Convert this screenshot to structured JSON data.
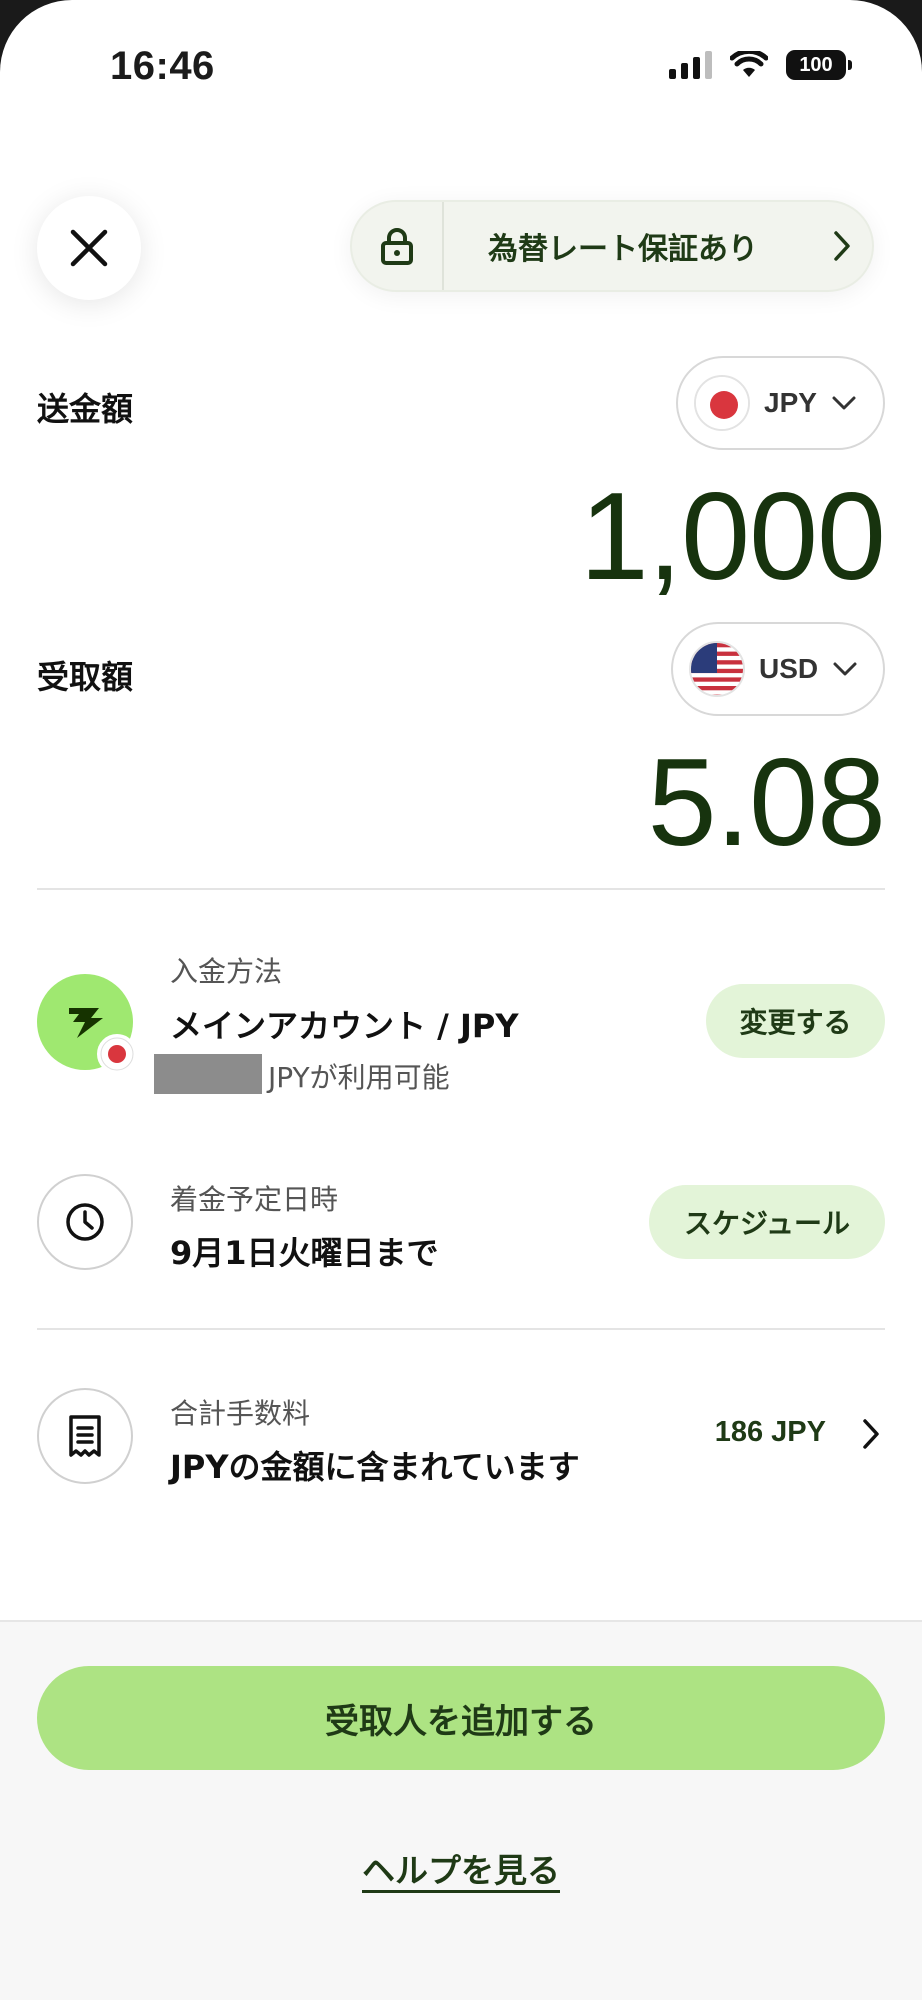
{
  "status_bar": {
    "time": "16:46",
    "battery": "100"
  },
  "header": {
    "rate_guarantee_label": "為替レート保証あり"
  },
  "send": {
    "label": "送金額",
    "currency": "JPY",
    "amount": "1,000"
  },
  "receive": {
    "label": "受取額",
    "currency": "USD",
    "amount": "5.08"
  },
  "payment_method": {
    "caption": "入金方法",
    "title": "メインアカウント / JPY",
    "sub": "JPYが利用可能",
    "button": "変更する"
  },
  "arrival": {
    "caption": "着金予定日時",
    "title": "9月1日火曜日まで",
    "button": "スケジュール"
  },
  "fees": {
    "caption": "合計手数料",
    "title": "JPYの金額に含まれています",
    "value": "186 JPY"
  },
  "actions": {
    "primary": "受取人を追加する",
    "help": "ヘルプを見る"
  },
  "colors": {
    "accent_green": "#ade383",
    "light_green": "#e3f4d8",
    "dark_green": "#17330e",
    "brand_green": "#9fe870"
  },
  "icons": [
    "close-icon",
    "lock-icon",
    "chevron-right-icon",
    "chevron-down-icon",
    "japan-flag-icon",
    "us-flag-icon",
    "wise-logo-icon",
    "clock-icon",
    "receipt-icon"
  ]
}
